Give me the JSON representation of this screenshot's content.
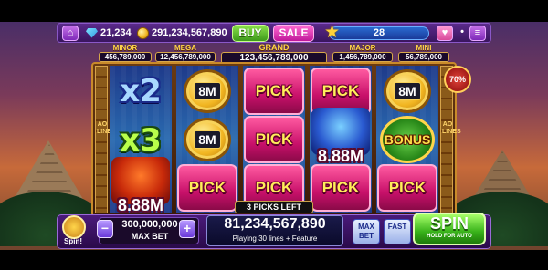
{
  "top": {
    "gems": "21,234",
    "coins": "291,234,567,890",
    "buy": "BUY",
    "sale": "SALE",
    "level": "28",
    "home_icon": "home-icon",
    "menu_icon": "menu-icon"
  },
  "jackpots": {
    "minor": {
      "name": "MINOR",
      "value": "456,789,000"
    },
    "mega": {
      "name": "MEGA",
      "value": "12,456,789,000"
    },
    "grand": {
      "name": "GRAND",
      "value": "123,456,789,000"
    },
    "major": {
      "name": "MAJOR",
      "value": "1,456,789,000"
    },
    "mini": {
      "name": "MINI",
      "value": "56,789,000"
    }
  },
  "pillar_text": "AO LINES",
  "badge": "70%",
  "reels": {
    "r1": {
      "c1": "x2",
      "c2": "x3",
      "c3_prize": "8.88M"
    },
    "r2": {
      "c1": "8M",
      "c2": "8M",
      "c3": "PICK"
    },
    "r3": {
      "c1": "PICK",
      "c2": "PICK",
      "c3": "PICK"
    },
    "r4": {
      "c1": "PICK",
      "c2_prize": "8.88M",
      "c3": "PICK"
    },
    "r5": {
      "c1": "8M",
      "c2": "BONUS",
      "c3": "PICK"
    }
  },
  "picks_left": "3 PICKS LEFT",
  "bottom": {
    "spin_small_label": "Spin!",
    "bet_value": "300,000,000",
    "bet_label": "MAX BET",
    "minus": "−",
    "plus": "+",
    "win_value": "81,234,567,890",
    "win_sub": "Playing 30 lines + Feature",
    "maxbet": "MAX BET",
    "fast": "FAST",
    "spin": "SPIN",
    "spin_sub": "HOLD FOR AUTO"
  }
}
